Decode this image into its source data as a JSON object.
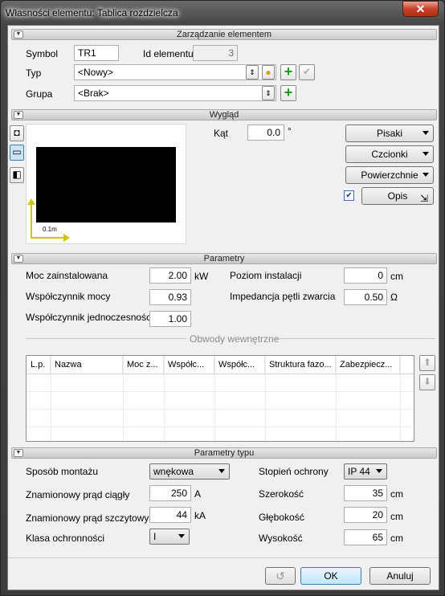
{
  "window": {
    "title": "Własności elementu: Tablica rozdzielcza",
    "close_label": "✕"
  },
  "sections": {
    "management": "Zarządzanie elementem",
    "appearance": "Wygląd",
    "parameters": "Parametry",
    "type_params": "Parametry typu",
    "internal_circuits": "Obwody wewnętrzne"
  },
  "management": {
    "symbol_label": "Symbol",
    "symbol_value": "TR1",
    "id_label": "Id elementu",
    "id_value": "3",
    "type_label": "Typ",
    "type_value": "<Nowy>",
    "group_label": "Grupa",
    "group_value": "<Brak>"
  },
  "appearance": {
    "angle_label": "Kąt",
    "angle_value": "0.0",
    "angle_unit": "°",
    "scale_label": "0.1m",
    "pens_label": "Pisaki",
    "fonts_label": "Czcionki",
    "surfaces_label": "Powierzchnie",
    "description_label": "Opis",
    "description_checked": true
  },
  "parameters": {
    "installed_power_label": "Moc zainstalowana",
    "installed_power_value": "2.00",
    "installed_power_unit": "kW",
    "power_factor_label": "Współczynnik mocy",
    "power_factor_value": "0.93",
    "simultaneity_label": "Współczynnik jednoczesności",
    "simultaneity_value": "1.00",
    "install_level_label": "Poziom instalacji",
    "install_level_value": "0",
    "install_level_unit": "cm",
    "loop_impedance_label": "Impedancja pętli zwarcia",
    "loop_impedance_value": "0.50",
    "loop_impedance_unit": "Ω"
  },
  "circuits_table": {
    "columns": [
      "L.p.",
      "Nazwa",
      "Moc z...",
      "Współc...",
      "Współc...",
      "Struktura fazo...",
      "Zabezpiecz..."
    ]
  },
  "type_params": {
    "mounting_label": "Sposób montażu",
    "mounting_value": "wnękowa",
    "rated_current_label": "Znamionowy prąd ciągły",
    "rated_current_value": "250",
    "rated_current_unit": "A",
    "peak_current_label": "Znamionowy prąd szczytowy",
    "peak_current_value": "44",
    "peak_current_unit": "kA",
    "protection_class_label": "Klasa ochronności",
    "protection_class_value": "I",
    "ip_label": "Stopień ochrony",
    "ip_value": "IP 44",
    "width_label": "Szerokość",
    "width_value": "35",
    "width_unit": "cm",
    "depth_label": "Głębokość",
    "depth_value": "20",
    "depth_unit": "cm",
    "height_label": "Wysokość",
    "height_value": "65",
    "height_unit": "cm"
  },
  "footer": {
    "undo_icon": "undo-icon",
    "ok_label": "OK",
    "cancel_label": "Anuluj"
  }
}
